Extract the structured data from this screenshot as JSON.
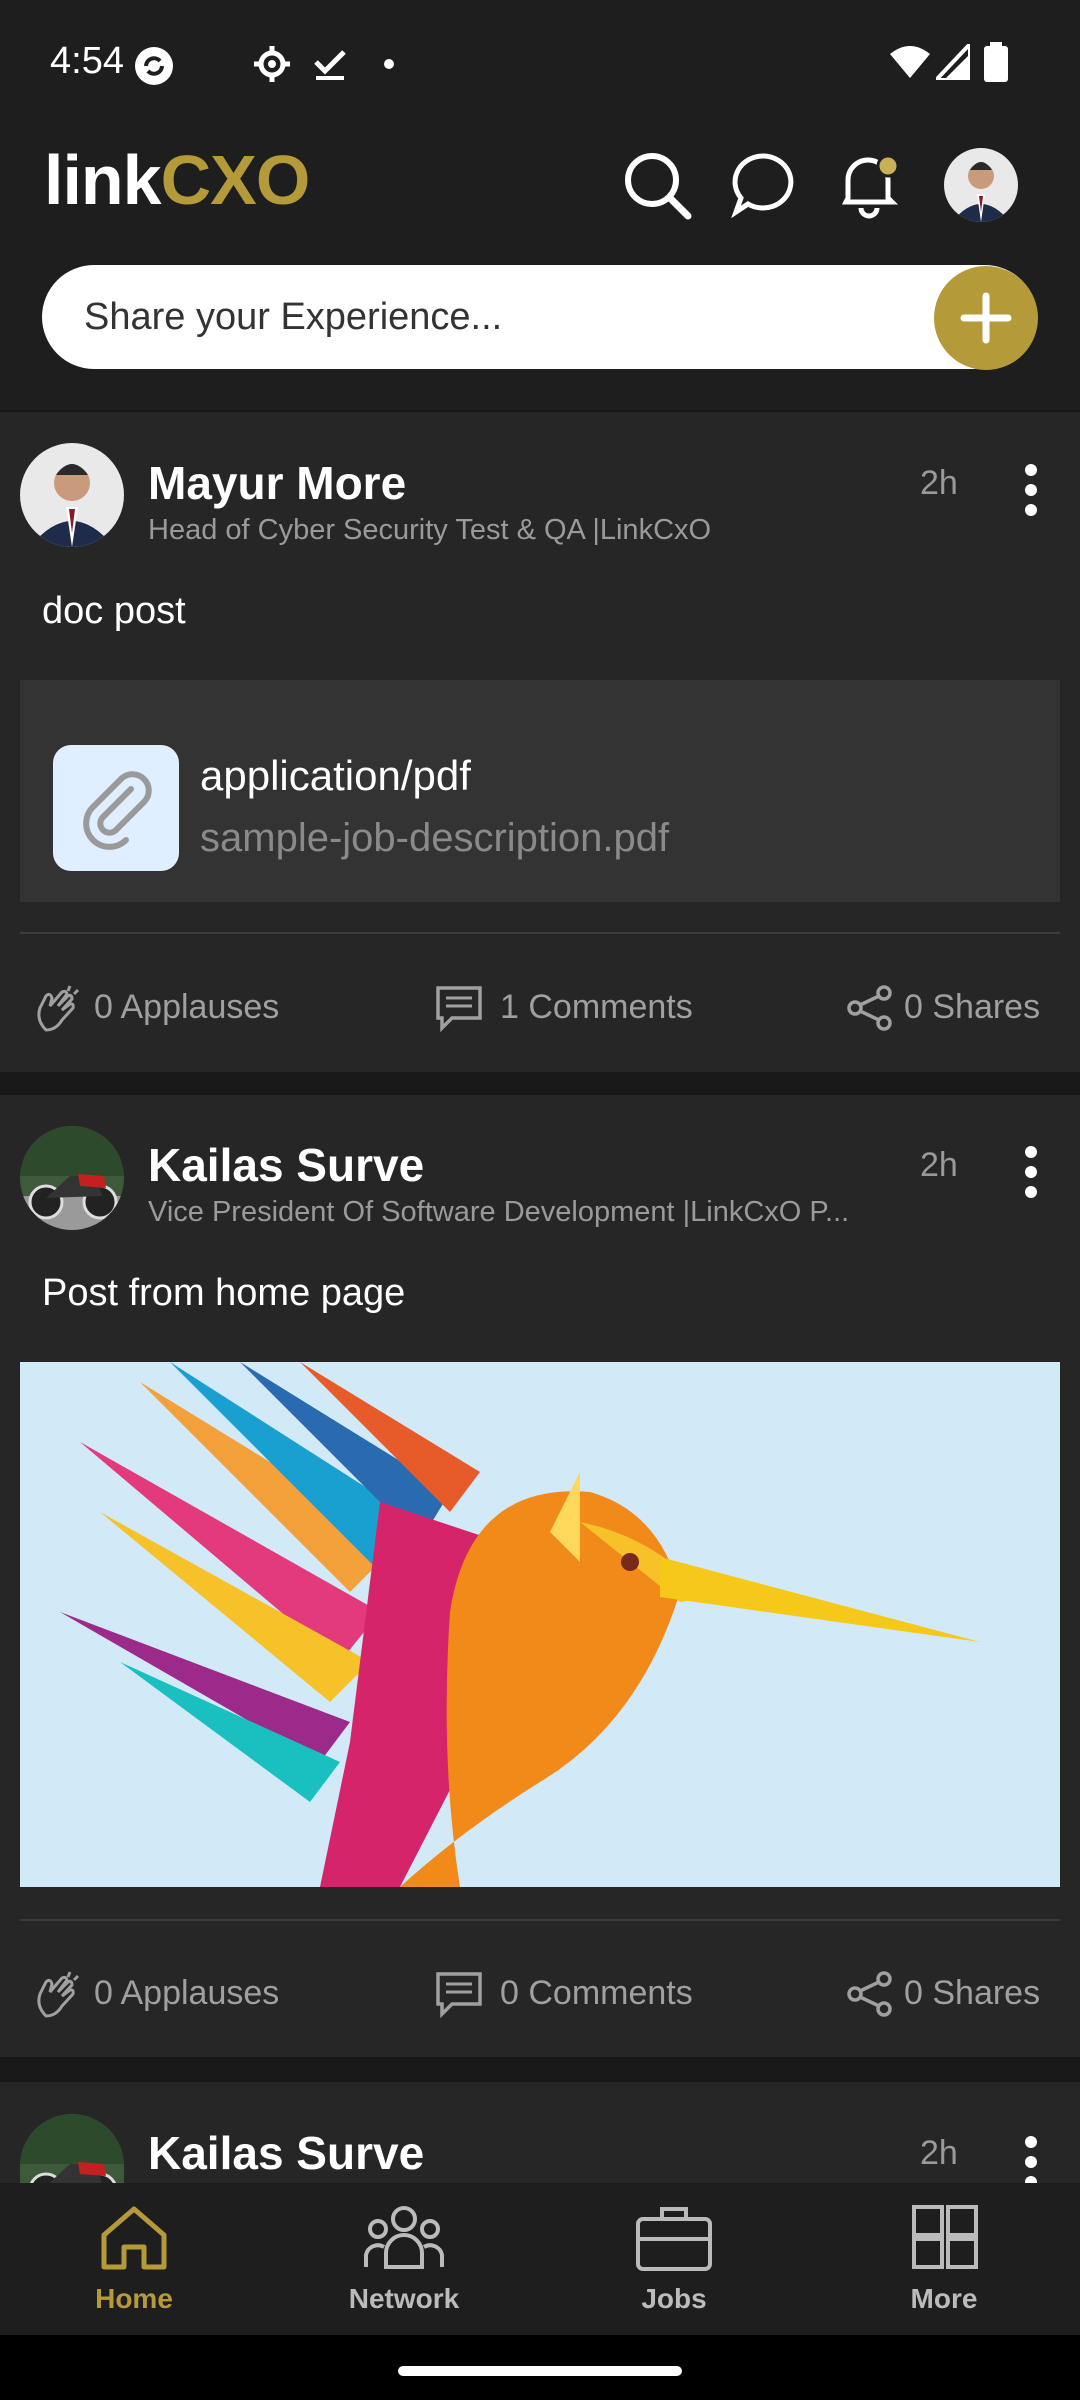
{
  "status_bar": {
    "time": "4:54"
  },
  "header": {
    "logo_link": "link",
    "logo_cxo": "CXO",
    "share_placeholder": "Share your Experience..."
  },
  "posts": [
    {
      "author": "Mayur More",
      "title": "Head of Cyber Security Test & QA |LinkCxO",
      "time": "2h",
      "text": "doc post",
      "attachment": {
        "mime": "application/pdf",
        "filename": "sample-job-description.pdf"
      },
      "applauses": "0 Applauses",
      "comments": "1 Comments",
      "shares": "0 Shares"
    },
    {
      "author": "Kailas Surve",
      "title": "Vice President Of Software Development |LinkCxO P...",
      "time": "2h",
      "text": "Post from home page",
      "applauses": "0 Applauses",
      "comments": "0 Comments",
      "shares": "0 Shares"
    },
    {
      "author": "Kailas Surve",
      "time": "2h"
    }
  ],
  "bottom_nav": [
    {
      "label": "Home",
      "active": true
    },
    {
      "label": "Network",
      "active": false
    },
    {
      "label": "Jobs",
      "active": false
    },
    {
      "label": "More",
      "active": false
    }
  ],
  "colors": {
    "accent": "#b59a3a",
    "background": "#181818",
    "card": "#262626"
  }
}
